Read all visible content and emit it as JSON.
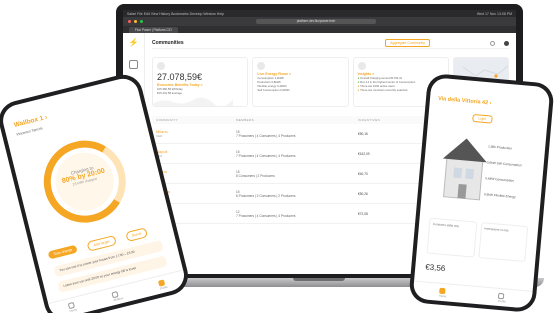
{
  "colors": {
    "accent": "#f5a623",
    "ok": "#4caf50",
    "dark": "#1d1d1f"
  },
  "mac_bar": {
    "left": "Safari  File  Edit  View  History  Bookmarks  Develop  Window  Help",
    "right": "Wed 17 Nov  13:08 PM"
  },
  "browser": {
    "url": "platform.dev.fluxpower.tech",
    "tab": "Flux Power | Platform CEI"
  },
  "sidebar": {
    "items": [
      "home-icon",
      "grid-icon",
      "share-icon"
    ]
  },
  "header": {
    "title": "Communities",
    "aggregate_button": "Aggregate Community"
  },
  "cards": {
    "economic": {
      "value": "27.078,59€",
      "label": "Economic Benefits Today >",
      "lines": [
        "105.360,55 kWh/day",
        "€15.231,58 average"
      ]
    },
    "energy": {
      "label": "Live Energy Flows >",
      "lines": [
        "Consumption 1,4kWh",
        "Production 0,8kWh",
        "Flexible energy 0,4kWh",
        "Self Consumption 0,6kWh"
      ]
    },
    "insights": {
      "label": "Insights >",
      "lines": [
        "Overall charging served €1703,41",
        "Ron 14 in the highest sector of Consumption",
        "There are 1000 active users",
        "There are members currently selected"
      ]
    }
  },
  "table": {
    "headers": [
      "COMMUNITY",
      "MEMBERS",
      "INCENTIVES"
    ],
    "rows": [
      {
        "name": "Milano",
        "sub": "CER",
        "members": [
          "15",
          "7 Prosumers | 4 Consumers | 4 Producers"
        ],
        "amount": "€50,16"
      },
      {
        "name": "Napoli",
        "sub": "CER",
        "members": [
          "15",
          "7 Prosumers | 4 Consumers | 4 Producers"
        ],
        "amount": "€162,09"
      },
      {
        "name": "Roma",
        "sub": "CER",
        "members": [
          "15",
          "8 Consumers | 2 Producers"
        ],
        "amount": "€40,70"
      },
      {
        "name": "Genova",
        "sub": "CER",
        "members": [
          "15",
          "6 Prosumers | 3 Consumers | 2 Producers"
        ],
        "amount": "€50,26"
      },
      {
        "name": "Lecceme",
        "sub": "CER",
        "members": [
          "12",
          "7 Prosumers | 4 Consumers | 4 Producers"
        ],
        "amount": "€72,08"
      }
    ]
  },
  "phone_left": {
    "title": "Wallbox 1 ›",
    "subtitle": "Vincenzo Tancini",
    "status": "Charging to",
    "percent": "80% by 20:00",
    "kwh": "23 kWh charged",
    "progress": 0.65,
    "buttons": {
      "stop": "Stop charge",
      "add": "Add target",
      "boost": "Boost"
    },
    "info1": "You can use it to power your house from 17:00 – 23:00",
    "info2": "Leave your car until 20:00 so your energy bill is lower",
    "nav": [
      "Home",
      "Wallbox",
      "Profile"
    ]
  },
  "phone_right": {
    "title": "Via della Vittoria 42 ›",
    "badge": "Light",
    "lines": [
      "1,88k Production",
      "0,6kW Self Consumption",
      "0,6kW Consumption",
      "0,6kW Flexible Energy"
    ],
    "mini": [
      "Consumo dalla rete",
      "Immissione in rete"
    ],
    "price": "€3,56",
    "nav": [
      "Home",
      "Profile"
    ]
  }
}
